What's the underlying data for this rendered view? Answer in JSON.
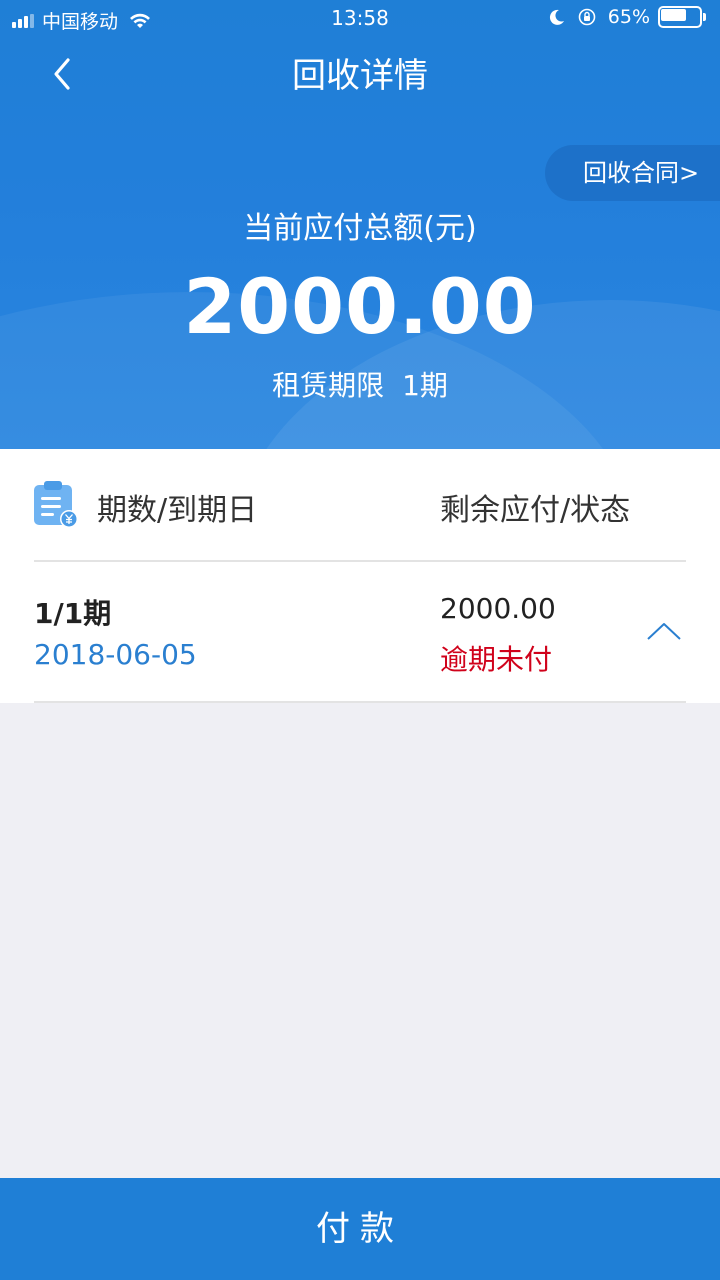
{
  "status_bar": {
    "carrier": "中国移动",
    "time": "13:58",
    "battery": "65%",
    "battery_level": 0.65
  },
  "nav": {
    "title": "回收详情",
    "back_icon": "chevron-left-icon"
  },
  "summary": {
    "contract_link": "回收合同>",
    "amount_label": "当前应付总额(元)",
    "amount": "2000.00",
    "lease_label": "租赁期限",
    "lease_value": "1期"
  },
  "list": {
    "header_icon": "clipboard-yen-icon",
    "col_left": "期数/到期日",
    "col_right": "剩余应付/状态",
    "rows": [
      {
        "period": "1/1期",
        "date": "2018-06-05",
        "amount": "2000.00",
        "status": "逾期未付"
      }
    ]
  },
  "actions": {
    "pay": "付款"
  },
  "colors": {
    "primary": "#1f7fd6",
    "overdue": "#d0021b",
    "date": "#2a7fd0",
    "background": "#efeff4"
  }
}
